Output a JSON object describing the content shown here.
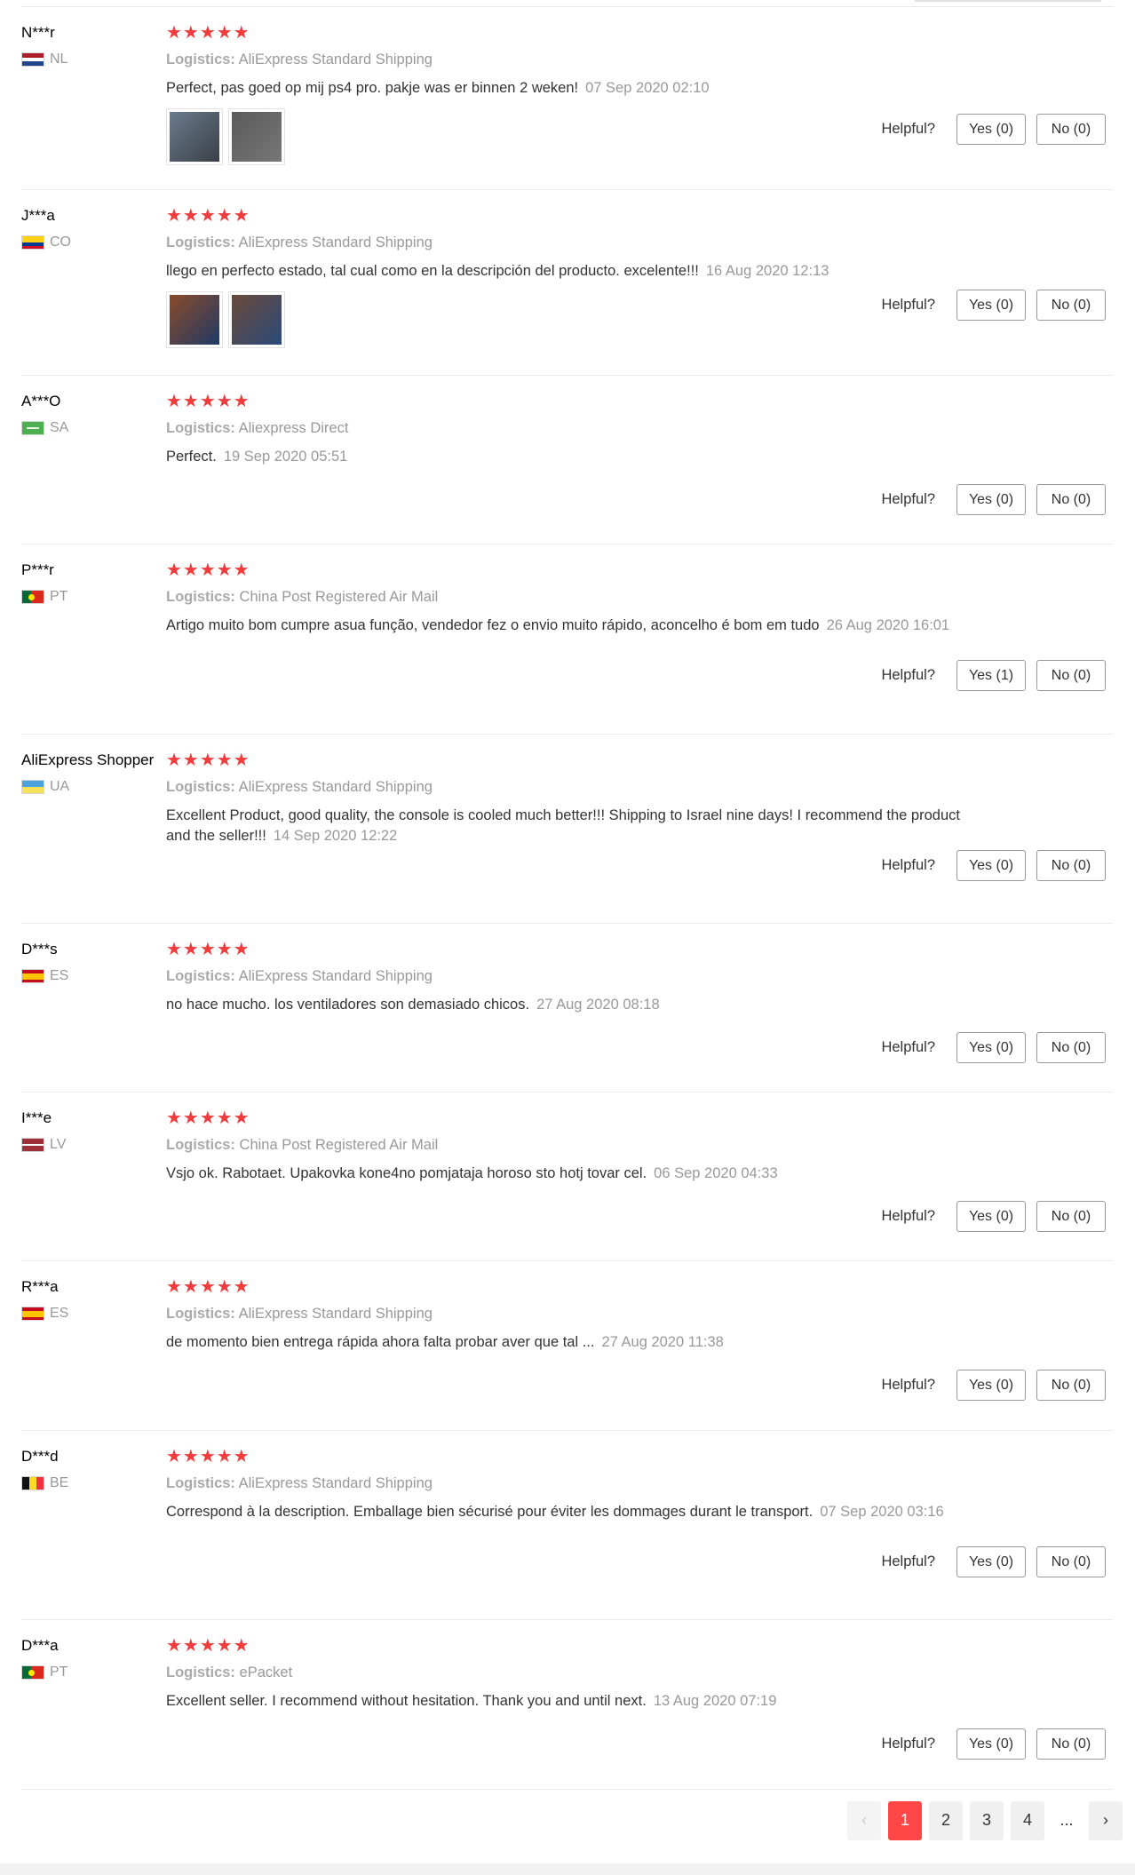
{
  "helpful_label": "Helpful?",
  "reviews": [
    {
      "user": "N***r",
      "country": "NL",
      "flag": "nl",
      "rating": "★★★★★",
      "logistics_label": "Logistics:",
      "logistics": "AliExpress Standard Shipping",
      "text": "Perfect, pas goed op mij ps4 pro. pakje was er binnen 2 weken!",
      "date": "07 Sep 2020 02:10",
      "photos": [
        {
          "name": "review-photo-1",
          "colors": [
            "#6a7b8c",
            "#3a3f47"
          ]
        },
        {
          "name": "review-photo-2",
          "colors": [
            "#5a5a5a",
            "#777"
          ]
        }
      ],
      "yes": "Yes (0)",
      "no": "No (0)"
    },
    {
      "user": "J***a",
      "country": "CO",
      "flag": "co",
      "rating": "★★★★★",
      "logistics_label": "Logistics:",
      "logistics": "AliExpress Standard Shipping",
      "text": "llego en perfecto estado, tal cual como en la descripción del producto. excelente!!!",
      "date": "16 Aug 2020 12:13",
      "photos": [
        {
          "name": "review-photo-1",
          "colors": [
            "#8a4a2a",
            "#1f3a66"
          ]
        },
        {
          "name": "review-photo-2",
          "colors": [
            "#6b4a3a",
            "#2a4a7a"
          ]
        }
      ],
      "yes": "Yes (0)",
      "no": "No (0)"
    },
    {
      "user": "A***O",
      "country": "SA",
      "flag": "sa",
      "rating": "★★★★★",
      "logistics_label": "Logistics:",
      "logistics": "Aliexpress Direct",
      "text": "Perfect.",
      "date": "19 Sep 2020 05:51",
      "photos": [],
      "yes": "Yes (0)",
      "no": "No (0)"
    },
    {
      "user": "P***r",
      "country": "PT",
      "flag": "pt",
      "rating": "★★★★★",
      "logistics_label": "Logistics:",
      "logistics": "China Post Registered Air Mail",
      "text": "Artigo muito bom cumpre asua função, vendedor fez o envio muito rápido, aconcelho é bom em tudo",
      "date": "26 Aug 2020 16:01",
      "photos": [],
      "yes": "Yes (1)",
      "no": "No (0)"
    },
    {
      "user": "AliExpress Shopper",
      "country": "UA",
      "flag": "ua",
      "rating": "★★★★★",
      "logistics_label": "Logistics:",
      "logistics": "AliExpress Standard Shipping",
      "text": "Excellent Product, good quality, the console is cooled much better!!! Shipping to Israel nine days! I recommend the product and the seller!!!",
      "date": "14 Sep 2020 12:22",
      "photos": [],
      "yes": "Yes (0)",
      "no": "No (0)"
    },
    {
      "user": "D***s",
      "country": "ES",
      "flag": "es",
      "rating": "★★★★★",
      "logistics_label": "Logistics:",
      "logistics": "AliExpress Standard Shipping",
      "text": "no hace mucho. los ventiladores son demasiado chicos.",
      "date": "27 Aug 2020 08:18",
      "photos": [],
      "yes": "Yes (0)",
      "no": "No (0)"
    },
    {
      "user": "I***e",
      "country": "LV",
      "flag": "lv",
      "rating": "★★★★★",
      "logistics_label": "Logistics:",
      "logistics": "China Post Registered Air Mail",
      "text": "Vsjo ok. Rabotaet. Upakovka kone4no pomjataja horoso sto hotj tovar cel.",
      "date": "06 Sep 2020 04:33",
      "photos": [],
      "yes": "Yes (0)",
      "no": "No (0)"
    },
    {
      "user": "R***a",
      "country": "ES",
      "flag": "es",
      "rating": "★★★★★",
      "logistics_label": "Logistics:",
      "logistics": "AliExpress Standard Shipping",
      "text": "de momento bien entrega rápida ahora falta probar aver que tal ...",
      "date": "27 Aug 2020 11:38",
      "photos": [],
      "yes": "Yes (0)",
      "no": "No (0)"
    },
    {
      "user": "D***d",
      "country": "BE",
      "flag": "be",
      "rating": "★★★★★",
      "logistics_label": "Logistics:",
      "logistics": "AliExpress Standard Shipping",
      "text": "Correspond à la description. Emballage bien sécurisé pour éviter les dommages durant le transport.",
      "date": "07 Sep 2020 03:16",
      "photos": [],
      "yes": "Yes (0)",
      "no": "No (0)"
    },
    {
      "user": "D***a",
      "country": "PT",
      "flag": "pt",
      "rating": "★★★★★",
      "logistics_label": "Logistics:",
      "logistics": "ePacket",
      "text": "Excellent seller. I recommend without hesitation. Thank you and until next.",
      "date": "13 Aug 2020 07:19",
      "photos": [],
      "yes": "Yes (0)",
      "no": "No (0)"
    }
  ],
  "pagination": {
    "prev_icon": "‹",
    "next_icon": "›",
    "pages": [
      "1",
      "2",
      "3",
      "4"
    ],
    "current": "1",
    "ellipsis": "..."
  },
  "colors": {
    "star": "#f03c3c",
    "active_page": "#ff4747",
    "muted_text": "#999999"
  }
}
